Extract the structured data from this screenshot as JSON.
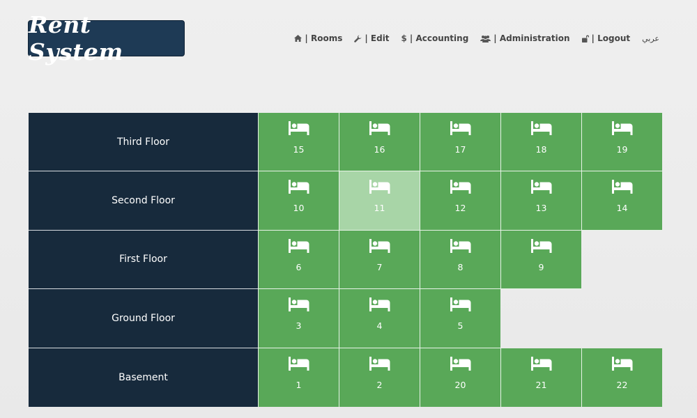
{
  "header": {
    "logo_text": "Rent System",
    "nav": [
      {
        "icon": "home-icon",
        "label": "| Rooms"
      },
      {
        "icon": "wrench-icon",
        "label": "| Edit"
      },
      {
        "icon": "dollar-icon",
        "label": "| Accounting"
      },
      {
        "icon": "users-icon",
        "label": "| Administration"
      },
      {
        "icon": "unlock-icon",
        "label": "| Logout"
      }
    ],
    "language_label": "عربي"
  },
  "floors": [
    {
      "name": "Third Floor",
      "rooms": [
        "15",
        "16",
        "17",
        "18",
        "19"
      ]
    },
    {
      "name": "Second Floor",
      "rooms": [
        "10",
        "11",
        "12",
        "13",
        "14"
      ]
    },
    {
      "name": "First Floor",
      "rooms": [
        "6",
        "7",
        "8",
        "9"
      ]
    },
    {
      "name": "Ground Floor",
      "rooms": [
        "3",
        "4",
        "5"
      ]
    },
    {
      "name": "Basement",
      "rooms": [
        "1",
        "2",
        "20",
        "21",
        "22"
      ]
    }
  ],
  "highlighted_room": "11",
  "colors": {
    "room_green": "#59a858",
    "room_highlight": "#a8d5a7",
    "floor_navy": "#172a3c",
    "logo_navy": "#1e3a55"
  }
}
